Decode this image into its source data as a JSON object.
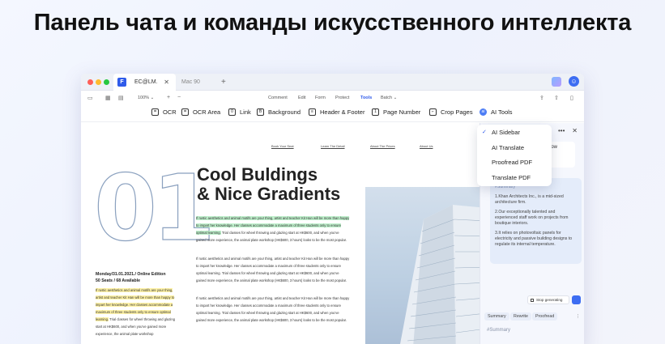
{
  "headline": "Панель чата и команды искусственного интеллекта",
  "window": {
    "tabs": [
      {
        "label": "EC@LM.",
        "active": true
      },
      {
        "label": "Mac 90",
        "active": false
      }
    ],
    "new_tab": "+",
    "close_glyph": "✕"
  },
  "menubar": {
    "zoom": "100% ⌄",
    "zoom_in": "+",
    "zoom_out": "−",
    "items": [
      "Comment",
      "Edit",
      "Form",
      "Protect",
      "Tools",
      "Batch ⌄"
    ],
    "active": "Tools"
  },
  "toolbar": {
    "tools": [
      {
        "label": "OCR",
        "icon": "ocr-icon",
        "glyph": "⌗"
      },
      {
        "label": "OCR Area",
        "icon": "ocr-area-icon",
        "glyph": "⌗"
      },
      {
        "label": "Link",
        "icon": "link-icon",
        "glyph": "0"
      },
      {
        "label": "Background",
        "icon": "background-icon",
        "glyph": "B"
      },
      {
        "label": "Header & Footer",
        "icon": "header-footer-icon",
        "glyph": "≡"
      },
      {
        "label": "Page Number",
        "icon": "page-number-icon",
        "glyph": "1"
      },
      {
        "label": "Crop Pages",
        "icon": "crop-icon",
        "glyph": "⌐"
      },
      {
        "label": "AI Tools",
        "icon": "ai-icon",
        "glyph": "ai"
      }
    ]
  },
  "dropdown": {
    "items": [
      "AI Sidebar",
      "AI Translate",
      "Proofread PDF",
      "Translate PDF"
    ],
    "checked": "AI Sidebar",
    "check_glyph": "✓"
  },
  "document": {
    "nav_links": [
      "Book Your Seat",
      "Learn The Detail",
      "About The Prices",
      "About Us"
    ],
    "big_number": "01",
    "title_line1": "Cool Buldings",
    "title_line2": "& Nice Gradients",
    "para_hl_green": "If rustic aesthetics and animal motifs are your thing, artist and teacher Kit Han will be more than happy to impart her knowledge. Her classes accommodate a maximum of three students only to ensure optimal learning.",
    "para_rest_1": " Trial classes for wheel throwing and glazing start at HK$600, and when you've gained more experience, the animal plate workshop (HK$600, 3 hours) looks to be the most popular.",
    "para_2": "If rustic aesthetics and animal motifs are your thing, artist and teacher Kit Han will be more than happy to impart her knowledge. Her classes accommodate a maximum of three students only to ensure optimal learning. Trial classes for wheel throwing and glazing start at HK$600, and when you've gained more experience, the animal plate workshop (HK$600, 3 hours) looks to be the most popular.",
    "para_3": "If rustic aesthetics and animal motifs are your thing, artist and teacher Kit Han will be more than happy to impart her knowledge. Her classes accommodate a maximum of three students only to ensure optimal learning. Trial classes for wheel throwing and glazing start at HK$600, and when you've gained more experience, the animal plate workshop (HK$600, 3 hours) looks to be the most popular.",
    "left_title_1": "Monday/31.01.2021./ Online Edition",
    "left_title_2": "50 Seats / 68 Available",
    "left_hl_yellow": "If rustic aesthetics and animal motifs are your thing, artist and teacher Kit Han will be more than happy to impart her knowledge. Her classes accommodate a maximum of three students only to ensure optimal learning.",
    "left_rest": " Trial classes for wheel throwing and glazing start at HK$600, and when you've gained more experience, the animal plate workshop"
  },
  "sidebar": {
    "card_text": "How",
    "summary_tag": "#Summary",
    "summary_points": [
      "1.Khan Architects Inc., is a mid-sized architecture firm.",
      "2.Our exceptionally talented and experienced staff work on projects from boutique interiors.",
      "3.It relies on photovoltaic panels for electricity and passive building designs to regulate its internal temperature."
    ],
    "stop_label": "Stop generating",
    "tabs": [
      "Summary",
      "Rewrite",
      "Proofread"
    ],
    "more": "⋮",
    "hash_tag": "#Summary",
    "top_more": "•••",
    "top_close": "✕"
  }
}
